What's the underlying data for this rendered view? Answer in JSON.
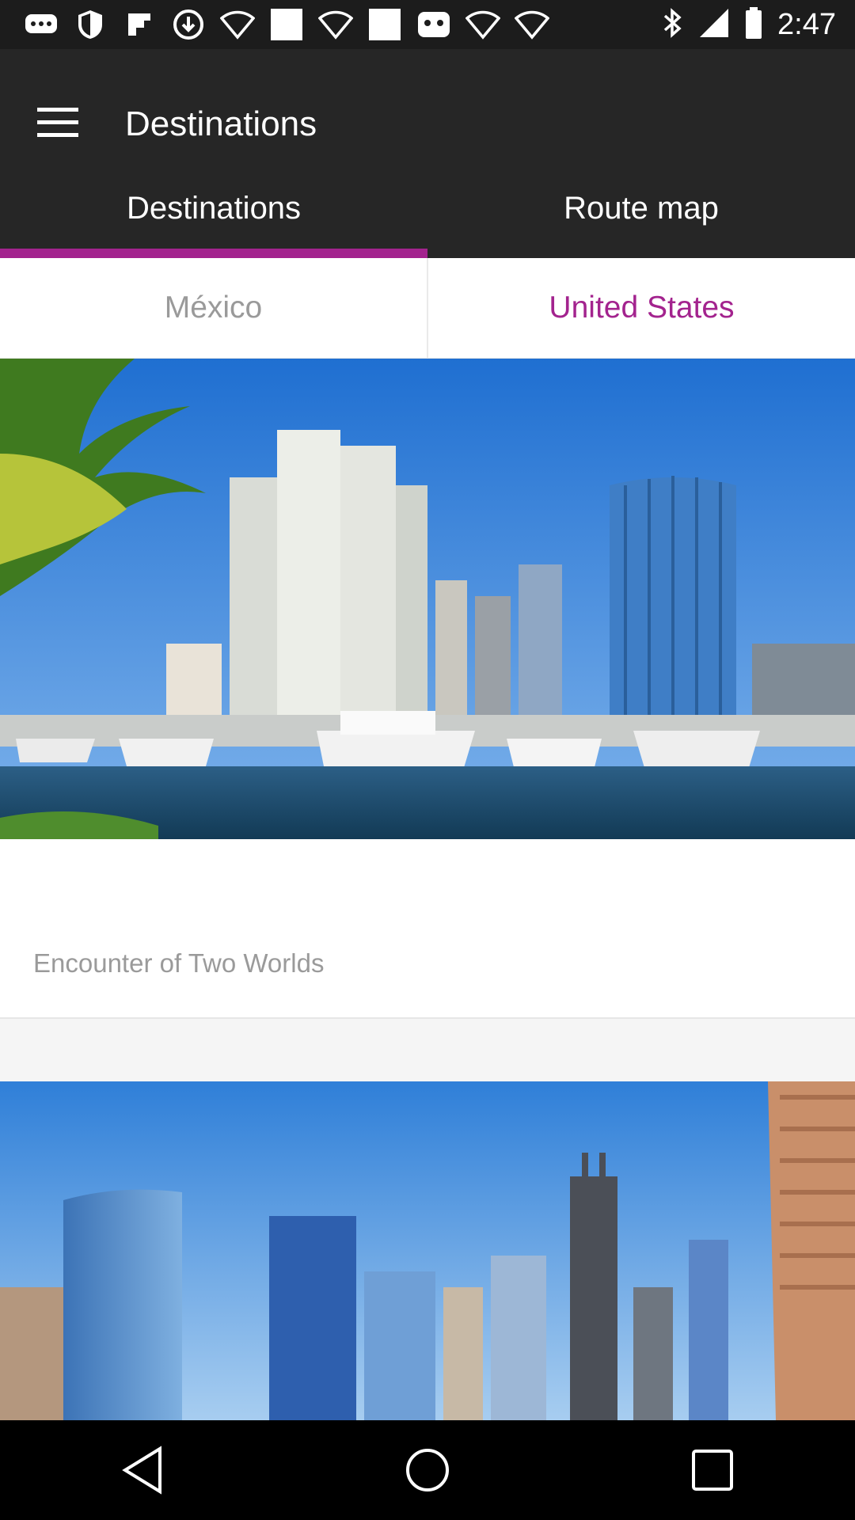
{
  "status_bar": {
    "time": "2:47",
    "icons": [
      "chat-icon",
      "shield-icon",
      "flipboard-icon",
      "download-icon",
      "wifi-icon",
      "square-icon",
      "wifi-icon",
      "square-icon",
      "game-icon",
      "wifi-icon",
      "wifi-icon"
    ],
    "right_icons": [
      "bluetooth-icon",
      "signal-icon",
      "battery-icon"
    ]
  },
  "app_bar": {
    "title": "Destinations",
    "menu_icon": "hamburger-menu-icon"
  },
  "tabs": [
    {
      "label": "Destinations",
      "active": true
    },
    {
      "label": "Route map",
      "active": false
    }
  ],
  "subtabs": [
    {
      "label": "México",
      "selected": false
    },
    {
      "label": "United States",
      "selected": true
    }
  ],
  "cards": [
    {
      "caption": "Encounter of Two Worlds",
      "image": "marina-with-hotels-and-boats"
    },
    {
      "caption": "",
      "image": "city-skyline-skyscrapers"
    }
  ],
  "nav_bar": {
    "buttons": [
      "back-icon",
      "home-icon",
      "recents-icon"
    ]
  },
  "colors": {
    "accent": "#a3238e",
    "appbar": "#262626",
    "statusbar": "#1c1c1c"
  }
}
